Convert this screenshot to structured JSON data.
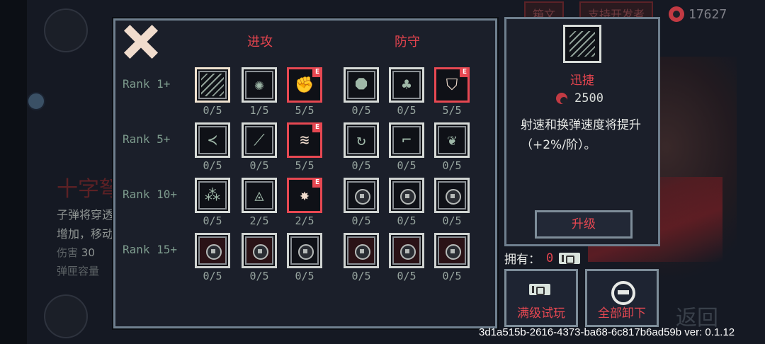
{
  "background": {
    "hud_buttons": [
      "箱文",
      "支持开发者"
    ],
    "currency": {
      "amount": "17627",
      "icon": "soul-coin-icon"
    },
    "weapon_title": "十字弩",
    "weapon_desc_lines": [
      "子弹将穿透",
      "增加，移动"
    ],
    "damage_label": "伤害",
    "damage_value": "30",
    "magazine_label": "弹匣容量",
    "return_label": "返回"
  },
  "panel": {
    "close_icon": "close-x-icon",
    "attack_header": "进攻",
    "defense_header": "防守",
    "ranks": [
      {
        "label": "Rank 1+",
        "slots": [
          {
            "count": "0/5",
            "icon": "hatch-stripes-icon",
            "state": "selected"
          },
          {
            "count": "1/5",
            "icon": "swirl-icon",
            "state": "normal"
          },
          {
            "count": "5/5",
            "icon": "fist-icon",
            "state": "equipped",
            "badge": "E"
          },
          {
            "count": "0/5",
            "icon": "octagon-cross-icon",
            "state": "normal"
          },
          {
            "count": "0/5",
            "icon": "cactus-icon",
            "state": "normal"
          },
          {
            "count": "5/5",
            "icon": "shield-icon",
            "state": "equipped",
            "badge": "E"
          }
        ]
      },
      {
        "label": "Rank 5+",
        "slots": [
          {
            "count": "0/5",
            "icon": "spread-shot-icon",
            "state": "normal"
          },
          {
            "count": "0/5",
            "icon": "slash-icon",
            "state": "normal"
          },
          {
            "count": "5/5",
            "icon": "wave-icon",
            "state": "equipped",
            "badge": "E"
          },
          {
            "count": "0/5",
            "icon": "cycle-icon",
            "state": "normal"
          },
          {
            "count": "0/5",
            "icon": "boot-icon",
            "state": "normal"
          },
          {
            "count": "0/5",
            "icon": "leaf-icon",
            "state": "normal"
          }
        ]
      },
      {
        "label": "Rank 10+",
        "slots": [
          {
            "count": "0/5",
            "icon": "orbs-icon",
            "state": "normal"
          },
          {
            "count": "2/5",
            "icon": "triangle-circle-icon",
            "state": "normal"
          },
          {
            "count": "2/5",
            "icon": "burst-icon",
            "state": "equipped",
            "badge": "E"
          },
          {
            "count": "0/5",
            "icon": "lock-icon",
            "state": "locked"
          },
          {
            "count": "0/5",
            "icon": "lock-icon",
            "state": "locked"
          },
          {
            "count": "0/5",
            "icon": "lock-icon",
            "state": "locked"
          }
        ]
      },
      {
        "label": "Rank 15+",
        "slots": [
          {
            "count": "0/5",
            "icon": "lock-icon",
            "state": "locked-red"
          },
          {
            "count": "0/5",
            "icon": "lock-icon",
            "state": "locked-red"
          },
          {
            "count": "0/5",
            "icon": "lock-icon",
            "state": "locked"
          },
          {
            "count": "0/5",
            "icon": "lock-icon",
            "state": "locked-red"
          },
          {
            "count": "0/5",
            "icon": "lock-icon",
            "state": "locked-red"
          },
          {
            "count": "0/5",
            "icon": "lock-icon",
            "state": "locked-red"
          }
        ]
      }
    ]
  },
  "detail": {
    "icon": "hatch-stripes-icon",
    "name": "迅捷",
    "cost": "2500",
    "description": "射速和换弹速度将提升（+2%/阶）。",
    "upgrade_label": "升级"
  },
  "owned": {
    "label": "拥有：",
    "count": "0"
  },
  "actions": {
    "trial_label": "满级试玩",
    "unequip_label": "全部卸下"
  },
  "version_text": "3d1a515b-2616-4373-ba68-6c817b6ad59b ver: 0.1.12",
  "colors": {
    "accent_red": "#e3444e",
    "panel_border": "#6f7f8e",
    "text_green": "#7d9b8d"
  }
}
